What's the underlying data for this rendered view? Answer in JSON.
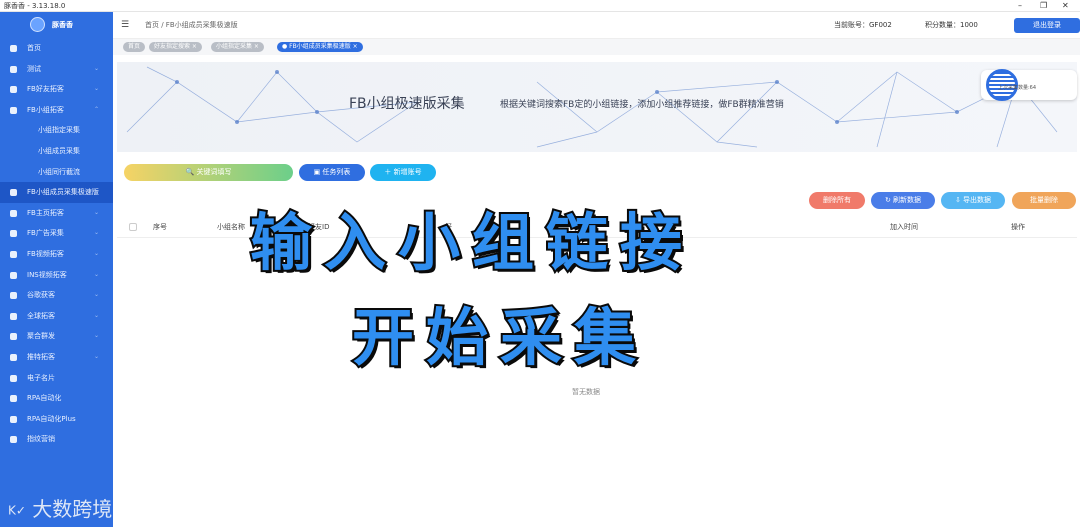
{
  "window": {
    "title": "豚香香 - 3.13.18.0",
    "minimize": "–",
    "maximize": "❐",
    "close": "✕"
  },
  "sidebar": {
    "logo_text": "豚香香",
    "items": [
      {
        "label": "首页",
        "chevron": ""
      },
      {
        "label": "测试",
        "chevron": "⌄"
      },
      {
        "label": "FB好友拓客",
        "chevron": "⌄"
      },
      {
        "label": "FB小组拓客",
        "chevron": "⌃"
      },
      {
        "label": "小组指定采集",
        "chevron": "",
        "sub": true
      },
      {
        "label": "小组成员采集",
        "chevron": "",
        "sub": true
      },
      {
        "label": "小组同行截流",
        "chevron": "",
        "sub": true
      },
      {
        "label": "FB小组成员采集极速版",
        "chevron": "",
        "active": true
      },
      {
        "label": "FB主页拓客",
        "chevron": "⌄"
      },
      {
        "label": "FB广告采集",
        "chevron": "⌄"
      },
      {
        "label": "FB视频拓客",
        "chevron": "⌄"
      },
      {
        "label": "INS视频拓客",
        "chevron": "⌄"
      },
      {
        "label": "谷歌获客",
        "chevron": "⌄"
      },
      {
        "label": "全球拓客",
        "chevron": "⌄"
      },
      {
        "label": "聚合群发",
        "chevron": "⌄"
      },
      {
        "label": "推特拓客",
        "chevron": "⌄"
      },
      {
        "label": "电子名片",
        "chevron": ""
      },
      {
        "label": "RPA自动化",
        "chevron": ""
      },
      {
        "label": "RPA自动化Plus",
        "chevron": ""
      },
      {
        "label": "指纹营销",
        "chevron": ""
      }
    ]
  },
  "header": {
    "menu_icon": "☰",
    "breadcrumb": "首页 / FB小组成员采集极速版",
    "account": "当前账号：GF002",
    "points": "积分数量：1000",
    "logout": "退出登录"
  },
  "tags": [
    {
      "label": "首页"
    },
    {
      "label": "好友指定搜索 ×"
    },
    {
      "label": "小组指定采集 ×"
    },
    {
      "label": "● FB小组成员采集极速版 ×",
      "active": true
    }
  ],
  "banner": {
    "title": "FB小组极速版采集",
    "subtitle": "根据关键词搜索FB定的小组链接，添加小组推荐链接，做FB群精准营销",
    "last_collect": "上次采集数量:64"
  },
  "buttons": {
    "keyword": "🔍 关键词填写",
    "task_list": "▣ 任务列表",
    "add_account": "＋ 新增账号",
    "delete_all": "删除所有",
    "refresh": "↻ 刷新数据",
    "export": "⇩ 导出数据",
    "batch_delete": "批量删除"
  },
  "table": {
    "columns": [
      "序号",
      "小组名称",
      "好友ID",
      "好",
      "加入时间",
      "操作"
    ],
    "empty_text": "暂无数据"
  },
  "overlay": {
    "line1": "输入小组链接",
    "line2": "开始采集"
  },
  "watermark": {
    "logo": "K✓",
    "text": "大数跨境"
  },
  "colors": {
    "sidebar": "#2f6ee0",
    "accent": "#2f6ee0",
    "caption": "#2f8ef0"
  }
}
